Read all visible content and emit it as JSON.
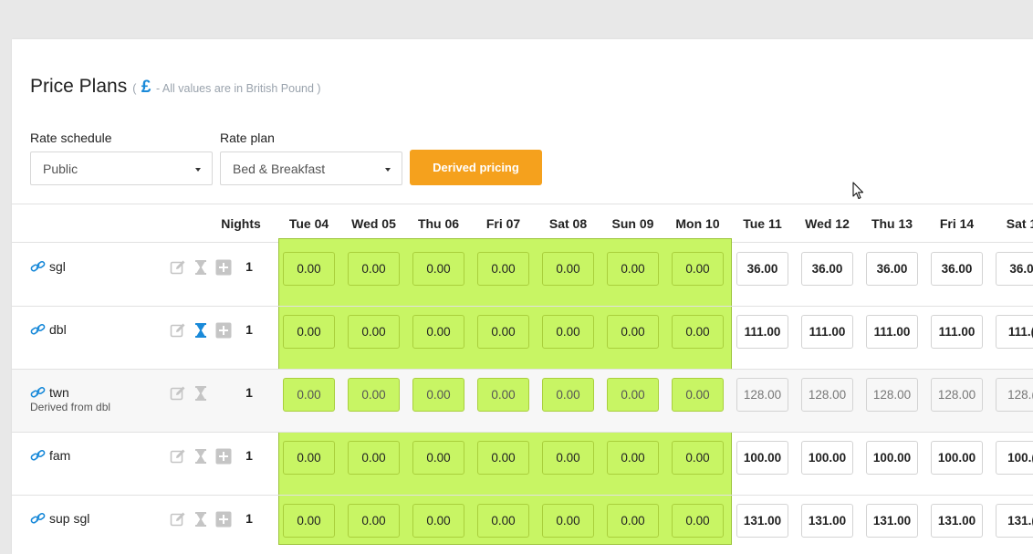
{
  "header": {
    "title": "Price Plans",
    "currency_open": "(",
    "currency_symbol": "£",
    "currency_note": "- All values are in British Pound )"
  },
  "filters": {
    "rate_schedule_label": "Rate schedule",
    "rate_schedule_value": "Public",
    "rate_plan_label": "Rate plan",
    "rate_plan_value": "Bed & Breakfast",
    "derived_button": "Derived pricing"
  },
  "table": {
    "nights_header": "Nights",
    "dates": [
      "Tue 04",
      "Wed 05",
      "Thu 06",
      "Fri 07",
      "Sat 08",
      "Sun 09",
      "Mon 10",
      "Tue 11",
      "Wed 12",
      "Thu 13",
      "Fri 14",
      "Sat 1"
    ],
    "rows": [
      {
        "name": "sgl",
        "sub": "",
        "nights": "1",
        "derived": false,
        "active_hourglass": false,
        "has_add": true,
        "values": [
          "0.00",
          "0.00",
          "0.00",
          "0.00",
          "0.00",
          "0.00",
          "0.00",
          "36.00",
          "36.00",
          "36.00",
          "36.00",
          "36.0"
        ]
      },
      {
        "name": "dbl",
        "sub": "",
        "nights": "1",
        "derived": false,
        "active_hourglass": true,
        "has_add": true,
        "values": [
          "0.00",
          "0.00",
          "0.00",
          "0.00",
          "0.00",
          "0.00",
          "0.00",
          "111.00",
          "111.00",
          "111.00",
          "111.00",
          "111.("
        ]
      },
      {
        "name": "twn",
        "sub": "Derived from dbl",
        "nights": "1",
        "derived": true,
        "active_hourglass": false,
        "has_add": false,
        "values": [
          "0.00",
          "0.00",
          "0.00",
          "0.00",
          "0.00",
          "0.00",
          "0.00",
          "128.00",
          "128.00",
          "128.00",
          "128.00",
          "128.("
        ]
      },
      {
        "name": "fam",
        "sub": "",
        "nights": "1",
        "derived": false,
        "active_hourglass": false,
        "has_add": true,
        "values": [
          "0.00",
          "0.00",
          "0.00",
          "0.00",
          "0.00",
          "0.00",
          "0.00",
          "100.00",
          "100.00",
          "100.00",
          "100.00",
          "100.("
        ]
      },
      {
        "name": "sup sgl",
        "sub": "",
        "nights": "1",
        "derived": false,
        "active_hourglass": false,
        "has_add": true,
        "values": [
          "0.00",
          "0.00",
          "0.00",
          "0.00",
          "0.00",
          "0.00",
          "0.00",
          "131.00",
          "131.00",
          "131.00",
          "131.00",
          "131.("
        ]
      }
    ]
  },
  "colors": {
    "accent_orange": "#f5a11d",
    "link_blue": "#1a8ad9",
    "selection_green": "#c8f564"
  }
}
